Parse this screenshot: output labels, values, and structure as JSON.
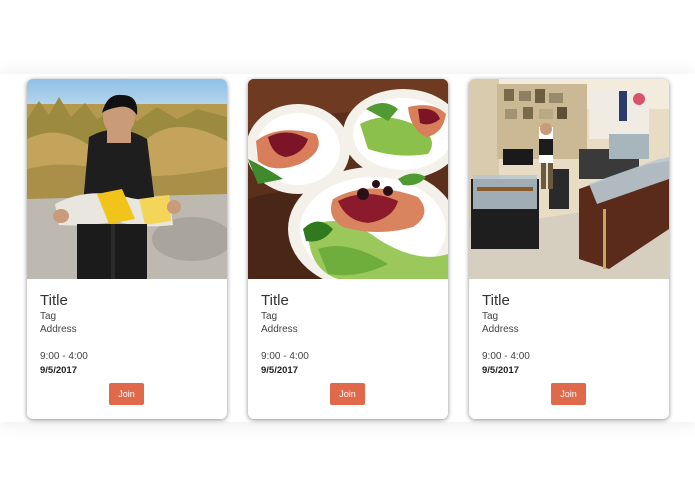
{
  "colors": {
    "join_button": "#e0694b",
    "card_background": "#ffffff",
    "page_background": "#ffffff"
  },
  "cards": [
    {
      "photo": "boy-reading-map-photo",
      "title": "Title",
      "tag": "Tag",
      "address": "Address",
      "hours": "9:00 - 4:00",
      "date": "9/5/2017",
      "join_label": "Join"
    },
    {
      "photo": "salmon-dish-photo",
      "title": "Title",
      "tag": "Tag",
      "address": "Address",
      "hours": "9:00 - 4:00",
      "date": "9/5/2017",
      "join_label": "Join"
    },
    {
      "photo": "shop-interior-photo",
      "title": "Title",
      "tag": "Tag",
      "address": "Address",
      "hours": "9:00 - 4:00",
      "date": "9/5/2017",
      "join_label": "Join"
    }
  ]
}
